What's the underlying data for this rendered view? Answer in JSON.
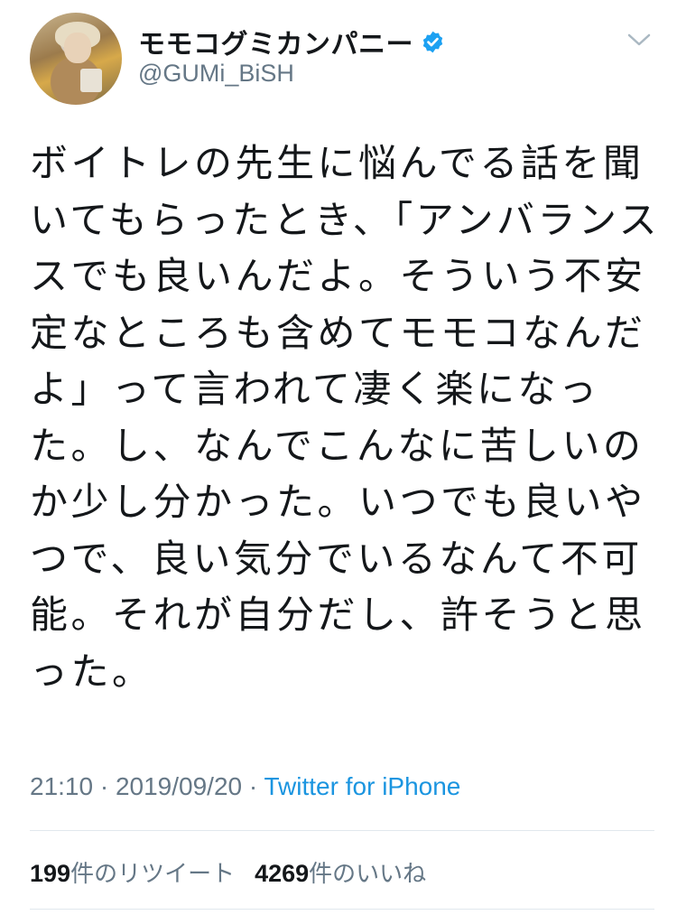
{
  "user": {
    "display_name": "モモコグミカンパニー",
    "handle": "@GUMi_BiSH",
    "verified": true
  },
  "tweet": {
    "lines": [
      "ボイトレの先生に悩んでる話を聞",
      "いてもらったとき、「アンバランス",
      "スでも良いんだよ。そういう不安",
      "定なところも含めてモモコなんだ",
      "よ」って言われて凄く楽になっ",
      "た。し、なんでこんなに苦しいの",
      "か少し分かった。いつでも良いや",
      "つで、良い気分でいるなんて不可",
      "能。それが自分だし、許そうと思",
      "った。"
    ],
    "time": "21:10",
    "date": "2019/09/20",
    "separator": "·",
    "source": "Twitter for iPhone"
  },
  "stats": {
    "retweet_count": "199",
    "retweet_label": "件のリツイート",
    "like_count": "4269",
    "like_label": "件のいいね"
  },
  "icons": {
    "verified": "verified-badge-icon",
    "menu": "chevron-down-icon"
  },
  "colors": {
    "verified_blue": "#1da1f2",
    "link_blue": "#1b95e0",
    "secondary_gray": "#657786"
  }
}
